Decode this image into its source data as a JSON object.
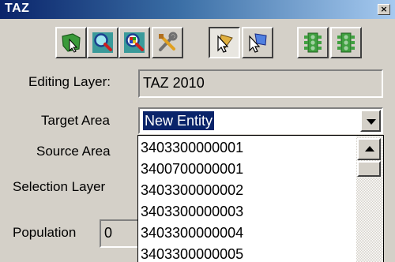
{
  "window": {
    "title": "TAZ",
    "close_glyph": "×"
  },
  "toolbar": {
    "buttons": [
      {
        "icon": "select-area-icon",
        "pressed": false
      },
      {
        "icon": "zoom-icon",
        "pressed": false
      },
      {
        "icon": "zoom-color-icon",
        "pressed": false
      },
      {
        "icon": "tools-icon",
        "pressed": false
      },
      {
        "icon": "pointer-select-icon",
        "pressed": true
      },
      {
        "icon": "pointer-add-icon",
        "pressed": false
      },
      {
        "icon": "traffic-light-icon",
        "pressed": false
      },
      {
        "icon": "traffic-light-icon",
        "pressed": false
      }
    ]
  },
  "form": {
    "editing_layer_label": "Editing Layer:",
    "editing_layer_value": "TAZ 2010",
    "target_area_label": "Target Area",
    "target_area_value": "New Entity",
    "source_area_label": "Source Area",
    "selection_layer_label": "Selection Layer",
    "population_label": "Population",
    "population_value": "0"
  },
  "dropdown": {
    "items": [
      "3403300000001",
      "3400700000001",
      "3403300000002",
      "3403300000003",
      "3403300000004",
      "3403300000005"
    ]
  }
}
